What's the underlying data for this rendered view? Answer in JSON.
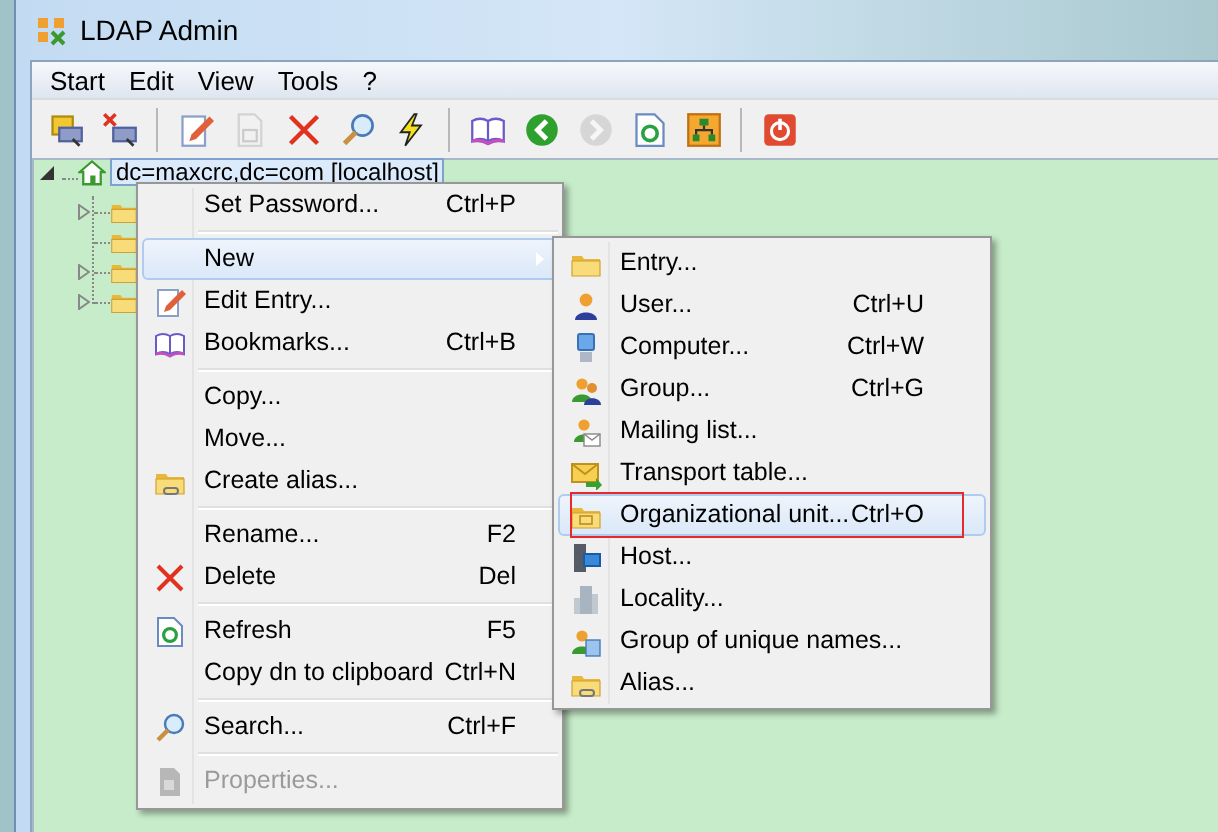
{
  "window": {
    "title": "LDAP Admin"
  },
  "menu_bar": [
    {
      "label": "Start"
    },
    {
      "label": "Edit"
    },
    {
      "label": "View"
    },
    {
      "label": "Tools"
    },
    {
      "label": "?"
    }
  ],
  "toolbar": [
    {
      "kind": "button",
      "disabled": false
    },
    {
      "kind": "button",
      "disabled": false
    },
    {
      "kind": "separator"
    },
    {
      "kind": "button",
      "disabled": false
    },
    {
      "kind": "button",
      "disabled": true
    },
    {
      "kind": "button",
      "disabled": false
    },
    {
      "kind": "button",
      "disabled": false
    },
    {
      "kind": "button",
      "disabled": false
    },
    {
      "kind": "separator"
    },
    {
      "kind": "button",
      "disabled": false
    },
    {
      "kind": "button",
      "disabled": false
    },
    {
      "kind": "button",
      "disabled": true
    },
    {
      "kind": "button",
      "disabled": false
    },
    {
      "kind": "button",
      "disabled": false
    },
    {
      "kind": "separator"
    },
    {
      "kind": "button",
      "disabled": false
    }
  ],
  "tree": {
    "root": {
      "label": "dc=maxcrc,dc=com [localhost]",
      "expanded": true,
      "selected": true,
      "children": [
        {
          "expandable": true
        },
        {
          "expandable": false
        },
        {
          "expandable": true
        },
        {
          "expandable": true
        }
      ]
    }
  },
  "context_menu": [
    {
      "kind": "item",
      "label": "Set Password...",
      "shortcut": "Ctrl+P",
      "selected": false,
      "disabled": false,
      "submenu": false
    },
    {
      "kind": "separator"
    },
    {
      "kind": "item",
      "label": "New",
      "selected": true,
      "disabled": false,
      "submenu": true
    },
    {
      "kind": "item",
      "label": "Edit Entry...",
      "selected": false,
      "disabled": false,
      "submenu": false
    },
    {
      "kind": "item",
      "label": "Bookmarks...",
      "shortcut": "Ctrl+B",
      "selected": false,
      "disabled": false,
      "submenu": false
    },
    {
      "kind": "separator"
    },
    {
      "kind": "item",
      "label": "Copy...",
      "selected": false,
      "disabled": false,
      "submenu": false
    },
    {
      "kind": "item",
      "label": "Move...",
      "selected": false,
      "disabled": false,
      "submenu": false
    },
    {
      "kind": "item",
      "label": "Create alias...",
      "selected": false,
      "disabled": false,
      "submenu": false
    },
    {
      "kind": "separator"
    },
    {
      "kind": "item",
      "label": "Rename...",
      "shortcut": "F2",
      "selected": false,
      "disabled": false,
      "submenu": false
    },
    {
      "kind": "item",
      "label": "Delete",
      "shortcut": "Del",
      "selected": false,
      "disabled": false,
      "submenu": false
    },
    {
      "kind": "separator"
    },
    {
      "kind": "item",
      "label": "Refresh",
      "shortcut": "F5",
      "selected": false,
      "disabled": false,
      "submenu": false
    },
    {
      "kind": "item",
      "label": "Copy dn to clipboard",
      "shortcut": "Ctrl+N",
      "selected": false,
      "disabled": false,
      "submenu": false
    },
    {
      "kind": "separator"
    },
    {
      "kind": "item",
      "label": "Search...",
      "shortcut": "Ctrl+F",
      "selected": false,
      "disabled": false,
      "submenu": false
    },
    {
      "kind": "separator"
    },
    {
      "kind": "item",
      "label": "Properties...",
      "selected": false,
      "disabled": true,
      "submenu": false
    }
  ],
  "submenu": [
    {
      "label": "Entry...",
      "selected": false,
      "annotated": false
    },
    {
      "label": "User...",
      "shortcut": "Ctrl+U",
      "selected": false,
      "annotated": false
    },
    {
      "label": "Computer...",
      "shortcut": "Ctrl+W",
      "selected": false,
      "annotated": false
    },
    {
      "label": "Group...",
      "shortcut": "Ctrl+G",
      "selected": false,
      "annotated": false
    },
    {
      "label": "Mailing list...",
      "selected": false,
      "annotated": false
    },
    {
      "label": "Transport table...",
      "selected": false,
      "annotated": false
    },
    {
      "label": "Organizational unit...",
      "shortcut": "Ctrl+O",
      "selected": true,
      "annotated": true
    },
    {
      "label": "Host...",
      "selected": false,
      "annotated": false
    },
    {
      "label": "Locality...",
      "selected": false,
      "annotated": false
    },
    {
      "label": "Group of unique names...",
      "selected": false,
      "annotated": false
    },
    {
      "label": "Alias...",
      "selected": false,
      "annotated": false
    }
  ]
}
